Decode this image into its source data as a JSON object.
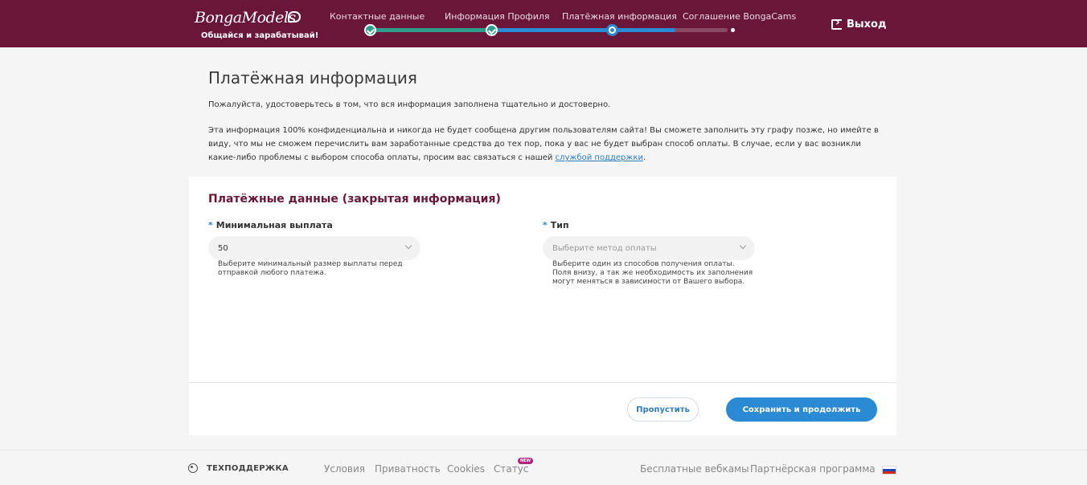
{
  "header": {
    "logo_text": "BongaModels",
    "logo_slogan": "Общайся и зарабатывай!",
    "steps": [
      {
        "label": "Контактные данные",
        "state": "done"
      },
      {
        "label": "Информация Профиля",
        "state": "done"
      },
      {
        "label": "Платёжная информация",
        "state": "current"
      },
      {
        "label": "Соглашение BongaCams",
        "state": "pending"
      }
    ],
    "logout_label": "Выход"
  },
  "page": {
    "title": "Платёжная информация",
    "intro_1": "Пожалуйста, удостоверьтесь в том, что вся информация заполнена тщательно и достоверно.",
    "intro_2": "Эта информация 100% конфиденциальна и никогда не будет сообщена другим пользователям сайта! Вы сможете заполнить эту графу позже, но имейте в виду, что мы не сможем перечислить вам заработанные средства до тех пор, пока у вас не будет выбран способ оплаты. В случае, если у вас возникли какие-либо проблемы с выбором способа оплаты, просим вас связаться с нашей",
    "support_link": "службой поддержки",
    "intro_2_end": "."
  },
  "form": {
    "section_title": "Платёжные данные (закрытая информация)",
    "required_mark": "*",
    "min_payout": {
      "label": "Минимальная выплата",
      "value": "50",
      "hint": "Выберите минимальный размер выплаты перед отправкой любого платежа."
    },
    "type": {
      "label": "Тип",
      "placeholder": "Выберите метод оплаты",
      "hint": "Выберите один из способов получения оплаты. Поля внизу, а так же необходимость их заполнения могут меняться в зависимости от Вашего выбора."
    },
    "skip_label": "Пропустить",
    "save_label": "Сохранить и продолжить"
  },
  "footer": {
    "support_label": "ТЕХПОДДЕРЖКА",
    "links": [
      "Условия",
      "Приватность",
      "Cookies",
      "Статус"
    ],
    "new_badge": "NEW",
    "right_links": [
      "Бесплатные вебкамы",
      "Партнёрская программа"
    ],
    "language": "ru"
  },
  "colors": {
    "header_bg": "#6a1638",
    "accent_blue": "#2a8ad3",
    "progress_green": "#2f9d8a",
    "section_title": "#6a1638"
  }
}
